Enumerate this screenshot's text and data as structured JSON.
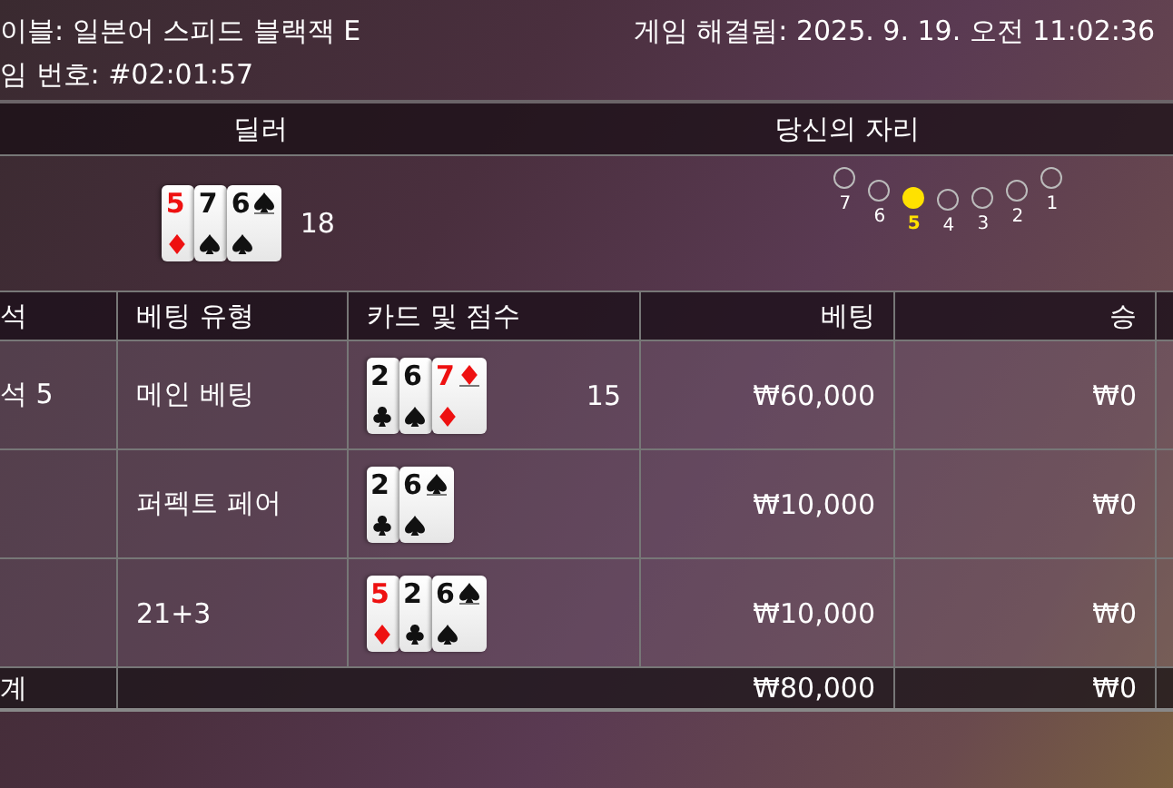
{
  "info": {
    "table": "이블: 일본어 스피드 블랙잭 E",
    "resolved": "게임 해결됨: 2025. 9. 19. 오전 11:02:36",
    "game_number": "임 번호: #02:01:57"
  },
  "summary_header": {
    "dealer": "딜러",
    "seat": "당신의 자리"
  },
  "dealer": {
    "cards": [
      {
        "rank": "5",
        "kind": "diamond"
      },
      {
        "rank": "7",
        "kind": "spade"
      },
      {
        "rank": "6",
        "kind": "spade"
      }
    ],
    "score": "18"
  },
  "seats": [
    {
      "label": "7",
      "selected": false
    },
    {
      "label": "6",
      "selected": false
    },
    {
      "label": "5",
      "selected": true
    },
    {
      "label": "4",
      "selected": false
    },
    {
      "label": "3",
      "selected": false
    },
    {
      "label": "2",
      "selected": false
    },
    {
      "label": "1",
      "selected": false
    }
  ],
  "table": {
    "columns": [
      "석",
      "베팅 유형",
      "카드 및 점수",
      "베팅",
      "승"
    ],
    "rows": [
      {
        "seat": "석 5",
        "bet_type": "메인 베팅",
        "cards": [
          {
            "rank": "2",
            "kind": "club"
          },
          {
            "rank": "6",
            "kind": "spade"
          },
          {
            "rank": "7",
            "kind": "diamond"
          }
        ],
        "score": "15",
        "bet": "₩60,000",
        "win": "₩0"
      },
      {
        "bet_type": "퍼펙트 페어",
        "cards": [
          {
            "rank": "2",
            "kind": "club"
          },
          {
            "rank": "6",
            "kind": "spade"
          }
        ],
        "bet": "₩10,000",
        "win": "₩0"
      },
      {
        "bet_type": "21+3",
        "cards": [
          {
            "rank": "5",
            "kind": "diamond"
          },
          {
            "rank": "2",
            "kind": "club"
          },
          {
            "rank": "6",
            "kind": "spade"
          }
        ],
        "bet": "₩10,000",
        "win": "₩0"
      }
    ],
    "total": {
      "label": "계",
      "bet": "₩80,000",
      "win": "₩0"
    }
  }
}
